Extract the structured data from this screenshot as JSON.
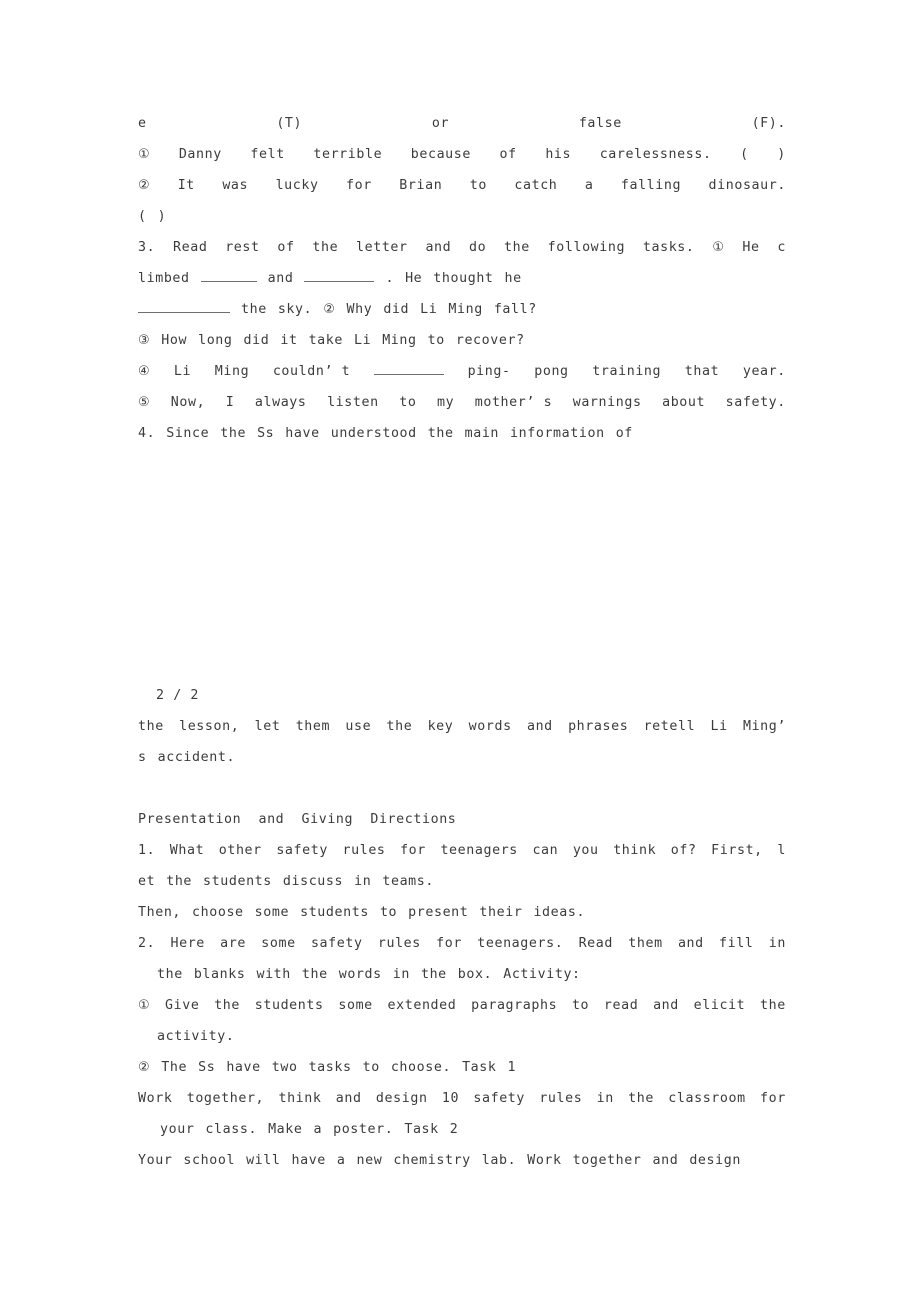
{
  "document": {
    "type": "lesson-plan-worksheet",
    "page_marker": "2 / 2",
    "background_color": "#ffffff",
    "text_color": "#3c3c3c"
  },
  "blocks": {
    "part_a": {
      "lines": [
        {
          "id": "l1",
          "segments": [
            "e",
            "(T)",
            "or",
            "false",
            "(F)."
          ]
        },
        {
          "id": "l2",
          "segments": [
            "①",
            "Danny",
            "felt",
            "terrible",
            "because",
            "of",
            "his",
            "carelessness.",
            "(",
            ")"
          ]
        },
        {
          "id": "l3",
          "segments": [
            "②",
            "It",
            "was",
            "lucky",
            "for",
            "Brian",
            "to",
            "catch",
            "a",
            "falling",
            "dinosaur."
          ]
        },
        {
          "id": "l4",
          "segments": [
            "(",
            ")"
          ]
        },
        {
          "id": "l5",
          "segments": [
            "3.",
            "Read",
            "rest",
            "of",
            "the",
            "letter",
            "and",
            "do",
            "the",
            "following",
            "tasks.",
            "①",
            "He",
            "c"
          ]
        },
        {
          "id": "l6",
          "segments": [
            "limbed",
            "____",
            "and",
            "_____",
            ".",
            "He",
            "thought",
            "he"
          ]
        },
        {
          "id": "l7",
          "segments": [
            "_______",
            "the",
            "sky.",
            "②",
            "Why",
            "did",
            "Li",
            "Ming",
            "fall?"
          ]
        },
        {
          "id": "l8",
          "segments": [
            "③",
            "How",
            "long",
            "did",
            "it",
            "take",
            "Li",
            "Ming",
            "to",
            "recover?"
          ]
        },
        {
          "id": "l9",
          "segments": [
            "④",
            "Li",
            "Ming",
            "couldn’ t",
            "_____",
            "ping-",
            "pong",
            "training",
            "that",
            "year."
          ]
        },
        {
          "id": "l10",
          "segments": [
            "⑤",
            "Now,",
            "I",
            "always",
            "listen",
            "to",
            "my",
            "mother’ s",
            "warnings",
            "about",
            "safety."
          ]
        },
        {
          "id": "l11",
          "segments": [
            "4.",
            "Since",
            "the",
            "Ss",
            "have",
            "understood",
            "the",
            "main",
            "information",
            "of"
          ]
        }
      ]
    },
    "page_break": {
      "marker": "2 / 2"
    },
    "part_b": {
      "lines": [
        {
          "id": "m1",
          "segments": [
            "the",
            "lesson,",
            "let",
            "them",
            "use",
            "the",
            "key",
            "words",
            "and",
            "phrases",
            "retell",
            "Li",
            "Ming’"
          ]
        },
        {
          "id": "m2",
          "segments": [
            "s",
            "accident."
          ]
        }
      ]
    },
    "part_c": {
      "heading": "Presentation  and  Giving  Directions",
      "lines": [
        {
          "id": "p1",
          "segments": [
            "1.",
            "What",
            "other",
            "safety",
            "rules",
            "for",
            "teenagers",
            "can",
            "you",
            "think",
            "of?",
            "First,",
            "l"
          ]
        },
        {
          "id": "p2",
          "segments": [
            "et",
            "the",
            "students",
            "discuss",
            "in",
            "teams."
          ]
        },
        {
          "id": "p3",
          "segments": [
            "Then,",
            "choose",
            "some",
            "students",
            "to",
            "present",
            "their",
            "ideas."
          ]
        },
        {
          "id": "p4",
          "segments": [
            "2.",
            "Here",
            "are",
            "some",
            "safety",
            "rules",
            "for",
            "teenagers.",
            "Read",
            "them",
            "and",
            "fill",
            "in"
          ]
        },
        {
          "id": "p5",
          "segments": [
            "the",
            "blanks",
            "with",
            "the",
            "words",
            "in",
            "the",
            "box.",
            "Activity:"
          ]
        },
        {
          "id": "p6",
          "segments": [
            "①",
            "Give",
            "the",
            "students",
            "some",
            "extended",
            "paragraphs",
            "to",
            "read",
            "and",
            "elicit",
            "the"
          ]
        },
        {
          "id": "p7",
          "segments": [
            "activity."
          ]
        },
        {
          "id": "p8",
          "segments": [
            "②",
            "The",
            "Ss",
            "have",
            "two",
            "tasks",
            "to",
            "choose.",
            "Task",
            "1"
          ]
        },
        {
          "id": "p9",
          "segments": [
            "Work",
            "together,",
            "think",
            "and",
            "design",
            "10",
            "safety",
            "rules",
            "in",
            "the",
            "classroom",
            "for"
          ]
        },
        {
          "id": "p10",
          "segments": [
            "your",
            "class.",
            "Make",
            "a",
            "poster.",
            "Task",
            "2"
          ]
        },
        {
          "id": "p11",
          "segments": [
            "Your",
            "school",
            "will",
            "have",
            "a",
            "new",
            "chemistry",
            "lab.",
            "Work",
            "together",
            "and",
            "design"
          ]
        }
      ]
    }
  }
}
